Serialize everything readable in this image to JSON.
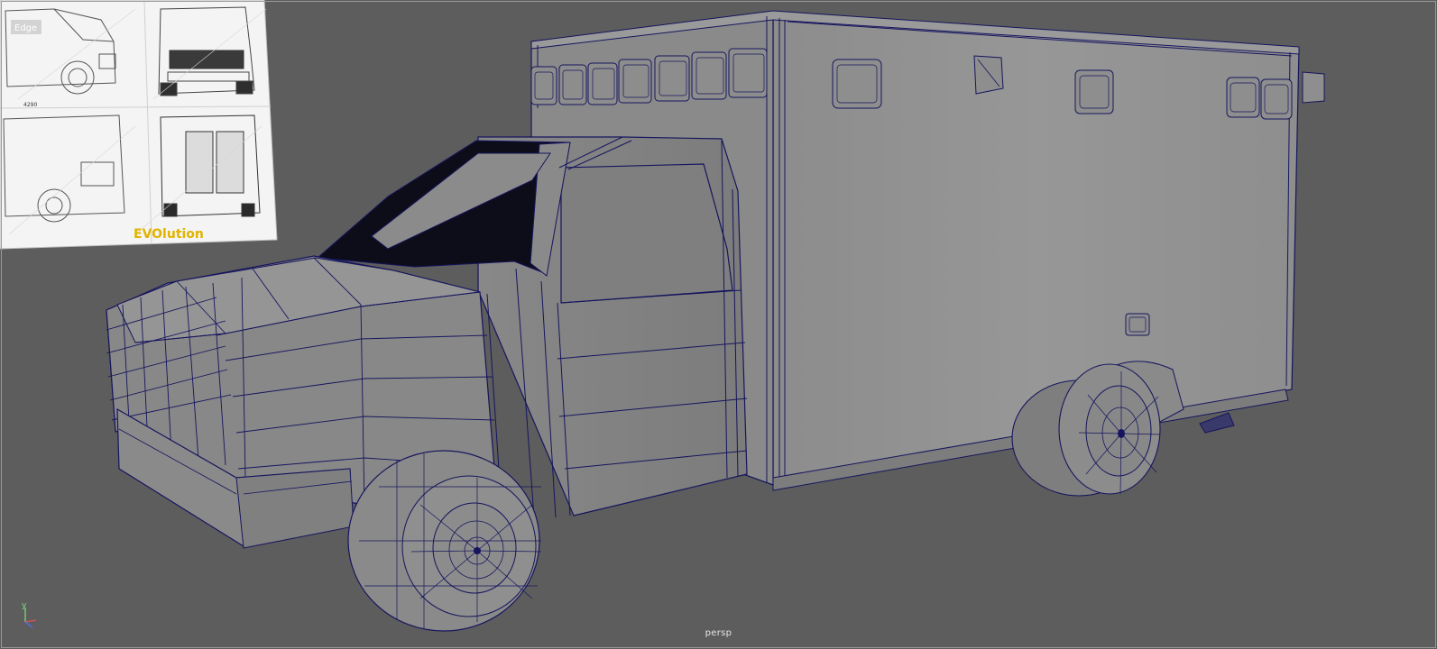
{
  "viewport": {
    "camera_label": "persp",
    "background_color": "#5d5d5d",
    "wire_color": "#16155e",
    "surface_color": "#8f8f8f"
  },
  "axis_indicator": {
    "y_label": "y",
    "y_color": "#7ee07e",
    "x_color": "#e05050",
    "z_color": "#4f6fff"
  },
  "reference_image": {
    "panel_label": "Edge",
    "plate_number": "4290",
    "brand_text": "EVOlution",
    "brand_color": "#e0b400"
  }
}
